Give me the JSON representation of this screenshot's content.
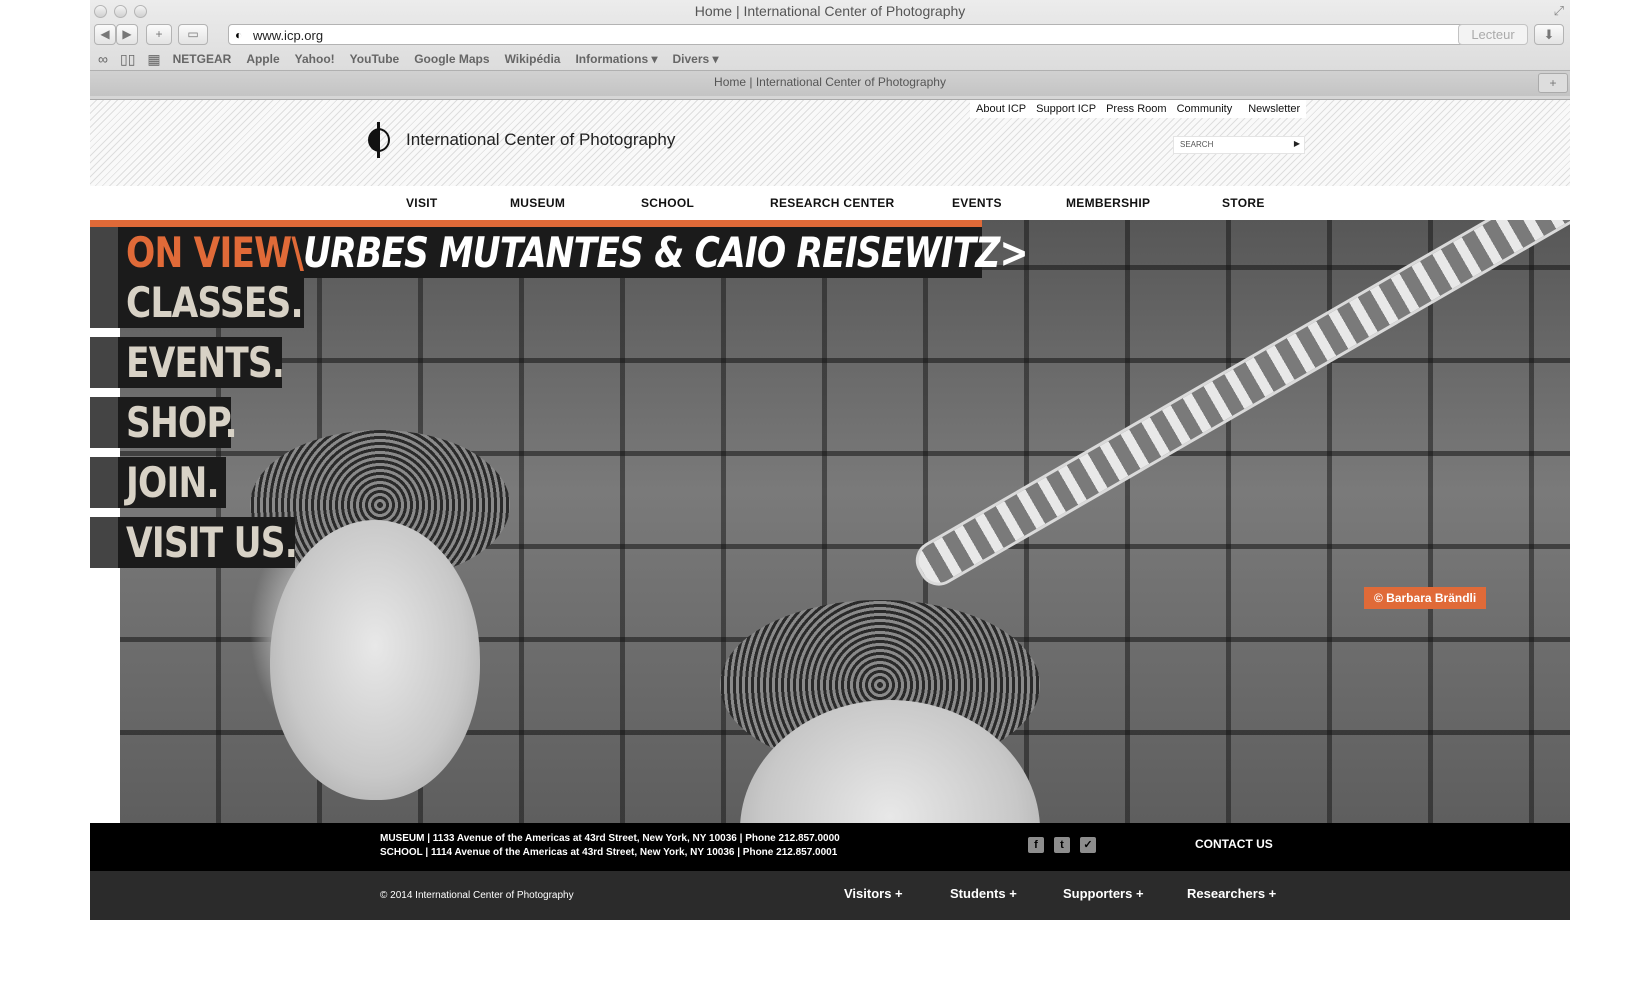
{
  "browser": {
    "window_title": "Home | International Center of Photography",
    "url": "www.icp.org",
    "reader_label": "Lecteur",
    "bookmarks": [
      "NETGEAR",
      "Apple",
      "Yahoo!",
      "YouTube",
      "Google Maps",
      "Wikipédia",
      "Informations ▾",
      "Divers ▾"
    ],
    "tab_title": "Home | International Center of Photography"
  },
  "site": {
    "logo_text": "International Center of Photography",
    "util_nav": [
      "About ICP",
      "Support ICP",
      "Press Room",
      "Community",
      "Newsletter"
    ],
    "search_placeholder": "SEARCH",
    "main_nav": [
      "VISIT",
      "MUSEUM",
      "SCHOOL",
      "RESEARCH CENTER",
      "EVENTS",
      "MEMBERSHIP",
      "STORE"
    ]
  },
  "hero": {
    "on_view_lead": "ON VIEW\\",
    "on_view_title": "URBES MUTANTES & CAIO REISEWITZ>",
    "headlines": [
      "CLASSES.",
      "EVENTS.",
      "SHOP.",
      "JOIN.",
      "VISIT US."
    ],
    "photo_credit": "© Barbara Brändli",
    "accent_color": "#e06a38"
  },
  "footer": {
    "museum_address": "MUSEUM | 1133 Avenue of the Americas at 43rd Street, New York, NY 10036 | Phone 212.857.0000",
    "school_address": "SCHOOL | 1114 Avenue of the Americas at 43rd Street, New York, NY 10036 | Phone 212.857.0001",
    "social_icons": [
      "facebook-icon",
      "twitter-icon",
      "email-icon"
    ],
    "contact_label": "CONTACT US",
    "copyright": "© 2014 International Center of Photography",
    "links": [
      "Visitors +",
      "Students +",
      "Supporters +",
      "Researchers +"
    ]
  }
}
